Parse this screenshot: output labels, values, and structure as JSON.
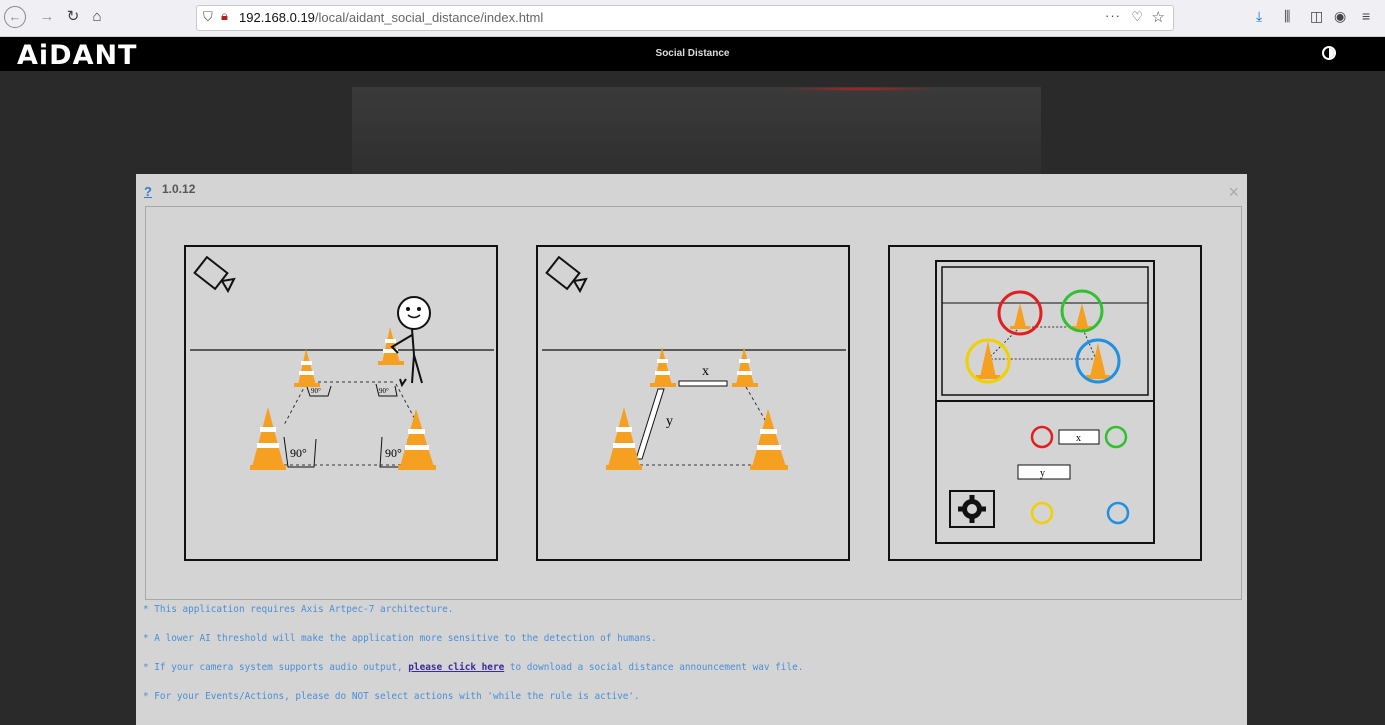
{
  "browser": {
    "url_host": "192.168.0.19",
    "url_path": "/local/aidant_social_distance/index.html",
    "more_label": "···"
  },
  "header": {
    "logo": "AiDANT",
    "title": "Social Distance"
  },
  "modal": {
    "help_label": "?",
    "version": "1.0.12",
    "close_label": "×",
    "panels": {
      "left_angle_small": "90°",
      "left_angle_large": "90°",
      "middle_x": "x",
      "middle_y": "y",
      "right_x": "x",
      "right_y": "y"
    },
    "notes": [
      "* This application requires Axis Artpec-7 architecture.",
      "* A lower AI threshold will make the application more sensitive to the detection of humans."
    ],
    "note3_prefix": "* If your camera system supports audio output, ",
    "note3_link": "please click here",
    "note3_suffix": " to download a social distance announcement wav file.",
    "note4": "* For your Events/Actions, please do NOT select actions with 'while the rule is active'."
  },
  "colors": {
    "cone_orange": "#f5a020",
    "circle_red": "#e02020",
    "circle_green": "#30c030",
    "circle_yellow": "#f0d000",
    "circle_blue": "#2090e0",
    "note_text": "#4a8fd8"
  }
}
